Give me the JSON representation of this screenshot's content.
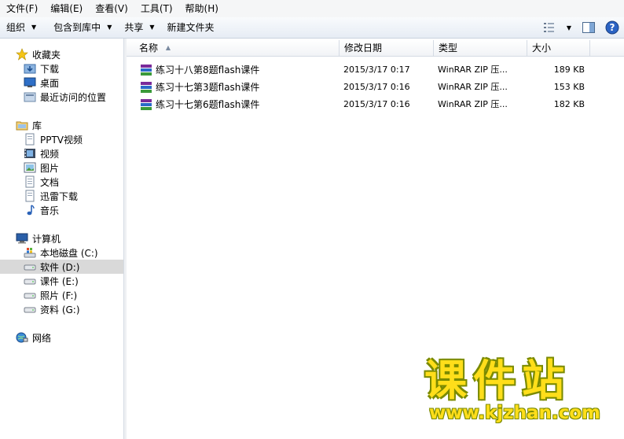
{
  "menubar": [
    {
      "label": "文件(F)"
    },
    {
      "label": "编辑(E)"
    },
    {
      "label": "查看(V)"
    },
    {
      "label": "工具(T)"
    },
    {
      "label": "帮助(H)"
    }
  ],
  "toolbar": {
    "organize": "组织",
    "include_library": "包含到库中",
    "share": "共享",
    "new_folder": "新建文件夹"
  },
  "nav": {
    "favorites": "收藏夹",
    "downloads": "下载",
    "desktop": "桌面",
    "recent": "最近访问的位置",
    "libraries": "库",
    "pptv": "PPTV视频",
    "videos": "视频",
    "pictures": "图片",
    "documents": "文档",
    "xunlei": "迅雷下载",
    "music": "音乐",
    "computer": "计算机",
    "drive_c": "本地磁盘 (C:)",
    "drive_d": "软件 (D:)",
    "drive_e": "课件 (E:)",
    "drive_f": "照片 (F:)",
    "drive_g": "资料 (G:)",
    "network": "网络"
  },
  "columns": {
    "name": "名称",
    "date": "修改日期",
    "type": "类型",
    "size": "大小"
  },
  "files": [
    {
      "name": "练习十八第8题flash课件",
      "date": "2015/3/17 0:17",
      "type": "WinRAR ZIP 压...",
      "size": "189 KB"
    },
    {
      "name": "练习十七第3题flash课件",
      "date": "2015/3/17 0:16",
      "type": "WinRAR ZIP 压...",
      "size": "153 KB"
    },
    {
      "name": "练习十七第6题flash课件",
      "date": "2015/3/17 0:16",
      "type": "WinRAR ZIP 压...",
      "size": "182 KB"
    }
  ],
  "watermark": {
    "text": "课件站",
    "url": "www.kjzhan.com"
  },
  "colors": {
    "selection": "#d9d9d9",
    "watermark": "#ffde1a"
  }
}
